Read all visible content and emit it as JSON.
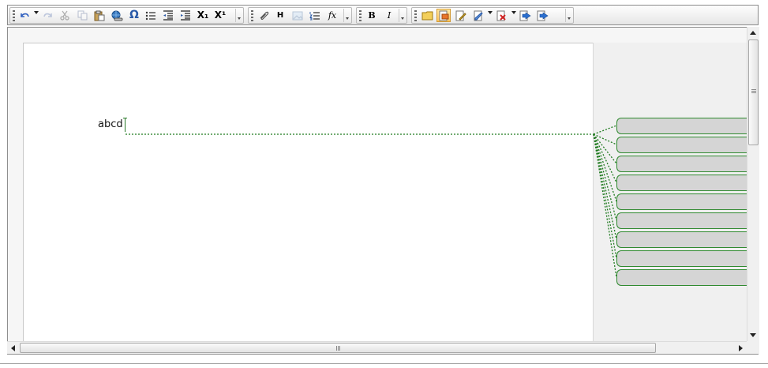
{
  "editor": {
    "document_text": "abcd",
    "comment_count": 9
  },
  "toolbar": {
    "group1": {
      "undo_icon": "undo-icon",
      "redo_icon": "redo-icon",
      "cut_icon": "cut-icon",
      "copy_icon": "copy-icon",
      "paste_icon": "paste-icon",
      "link_icon": "hyperlink-icon",
      "symbol_label": "Ω",
      "bullet_list_icon": "bullet-list-icon",
      "outdent_icon": "outdent-icon",
      "indent_icon": "indent-icon",
      "subscript_label": "X₁",
      "superscript_label": "X¹"
    },
    "group2": {
      "insert_link_icon": "paperclip-icon",
      "heading_label": "H",
      "image_icon": "image-icon",
      "numbered_list_icon": "numbered-list-icon",
      "formula_label": "fx"
    },
    "group3": {
      "bold_label": "B",
      "italic_label": "I"
    },
    "group4": {
      "new_comment_icon": "new-comment-icon",
      "show_comments_icon": "comments-icon",
      "edit_icon": "edit-icon",
      "track_changes_icon": "track-changes-icon",
      "reject_icon": "reject-change-icon",
      "previous_change_icon": "previous-change-icon",
      "next_change_icon": "next-change-icon"
    }
  },
  "colors": {
    "accent_green": "#1f7a1f",
    "comment_fill": "#d5d5d5",
    "active_button": "#ffc45c"
  }
}
